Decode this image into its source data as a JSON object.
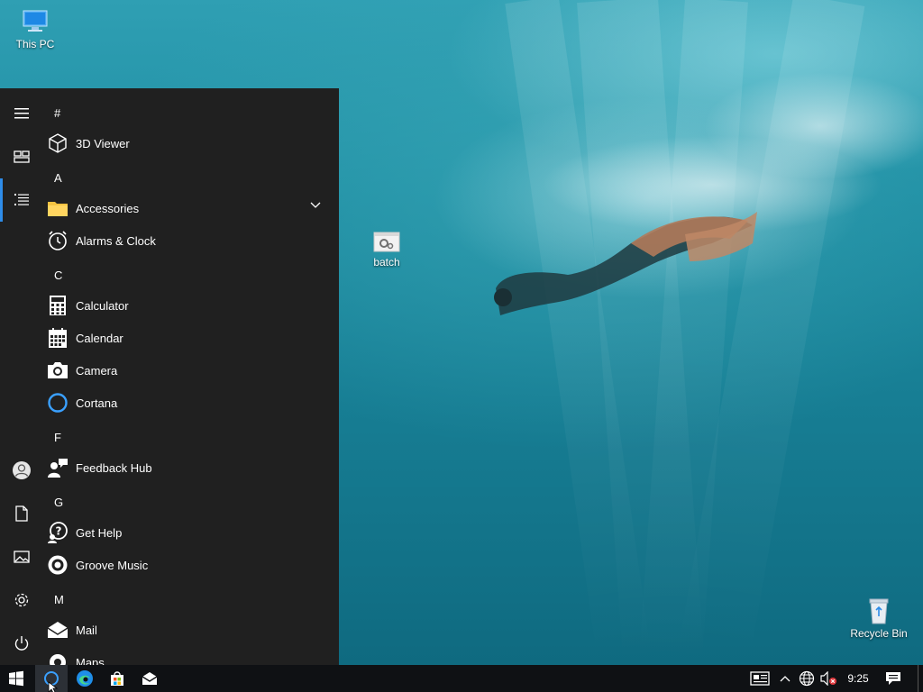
{
  "desktop": {
    "icons": [
      {
        "label": "This PC",
        "icon": "this-pc-icon"
      },
      {
        "label": "batch",
        "icon": "batch-file-icon"
      },
      {
        "label": "Recycle Bin",
        "icon": "recycle-bin-icon"
      }
    ]
  },
  "start_menu": {
    "rail": [
      {
        "name": "expand-menu-button",
        "icon": "hamburger-icon"
      },
      {
        "name": "tiles-view-button",
        "icon": "tiles-icon"
      },
      {
        "name": "all-apps-button",
        "icon": "list-icon"
      },
      {
        "name": "account-button",
        "icon": "user-avatar-icon"
      },
      {
        "name": "documents-button",
        "icon": "document-icon"
      },
      {
        "name": "pictures-button",
        "icon": "pictures-icon"
      },
      {
        "name": "settings-button",
        "icon": "gear-icon"
      },
      {
        "name": "power-button",
        "icon": "power-icon"
      }
    ],
    "groups": {
      "hash": "#",
      "a": "A",
      "c": "C",
      "f": "F",
      "g": "G",
      "m": "M"
    },
    "apps": {
      "viewer3d": "3D Viewer",
      "accessories": "Accessories",
      "alarms": "Alarms & Clock",
      "calculator": "Calculator",
      "calendar": "Calendar",
      "camera": "Camera",
      "cortana": "Cortana",
      "feedback": "Feedback Hub",
      "gethelp": "Get Help",
      "groove": "Groove Music",
      "mail": "Mail",
      "maps": "Maps"
    }
  },
  "taskbar": {
    "pinned": [
      "start-icon",
      "cortana-search-icon",
      "edge-icon",
      "store-icon",
      "mail-icon"
    ],
    "clock": "9:25",
    "tray": [
      "news-icon",
      "chevron-up-icon",
      "network-icon",
      "volume-muted-icon",
      "action-center-icon"
    ]
  },
  "colors": {
    "menu_bg": "#202020",
    "taskbar_bg": "#0f1114",
    "accent": "#2e8ce8",
    "cortana_ring": "#3aa0ff"
  }
}
